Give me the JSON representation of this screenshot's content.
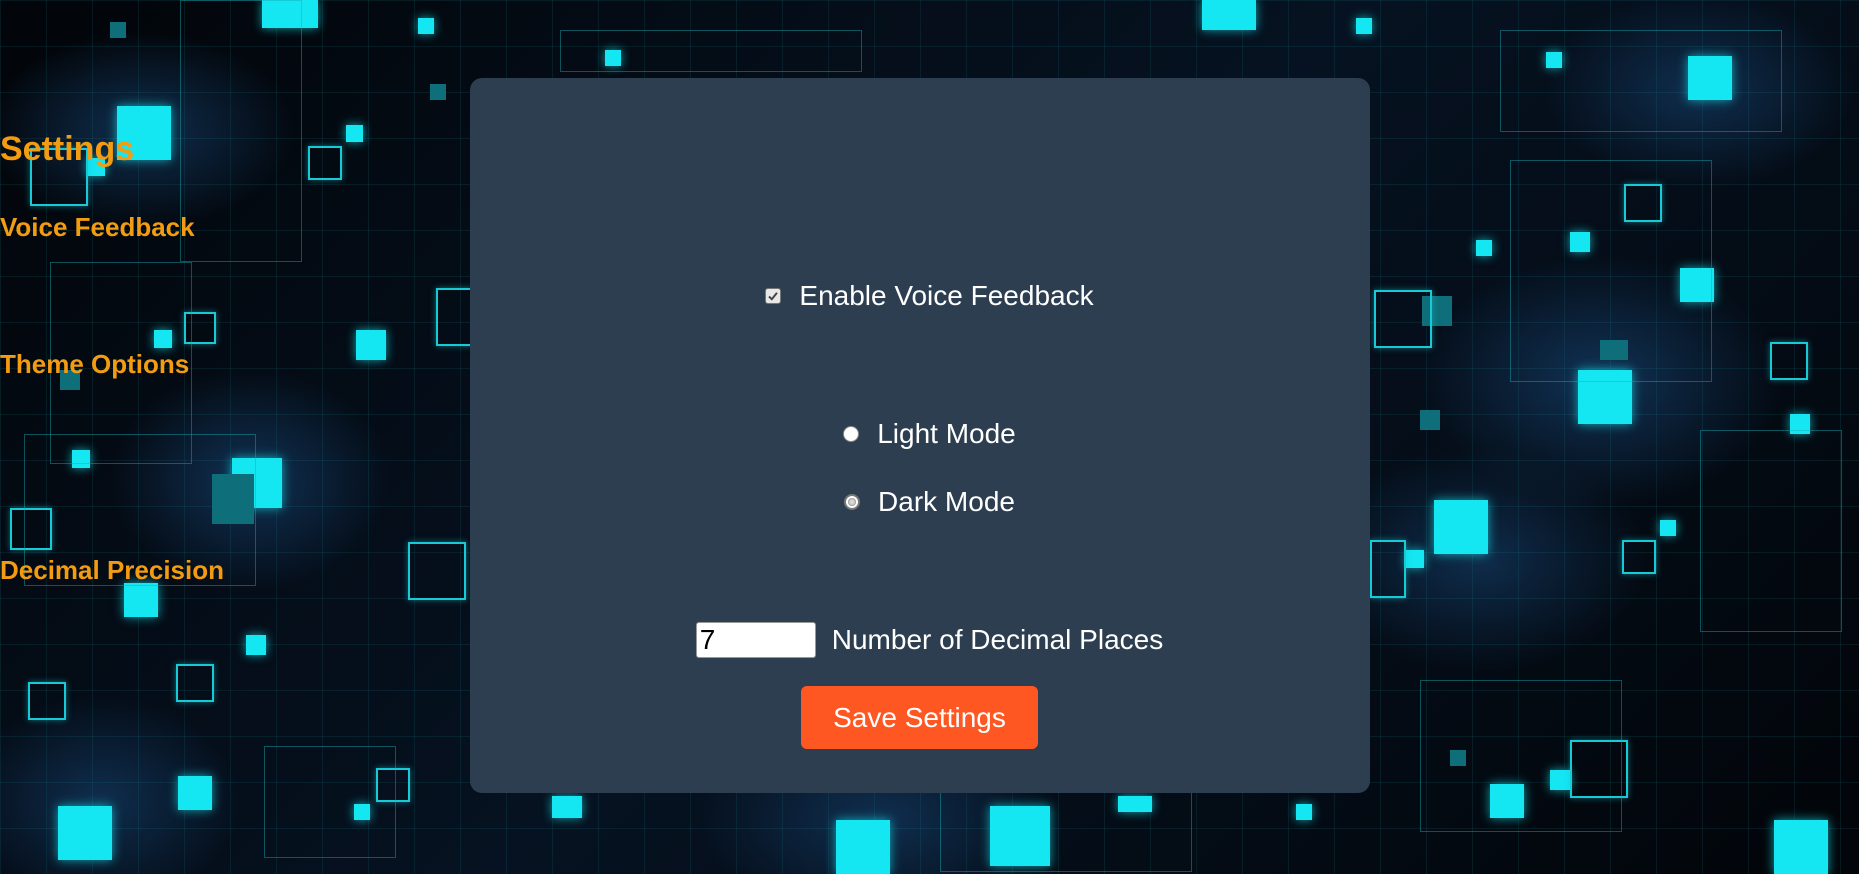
{
  "settings": {
    "title": "Settings",
    "voice_feedback": {
      "heading": "Voice Feedback",
      "enable_label": "Enable Voice Feedback",
      "enabled": true
    },
    "theme": {
      "heading": "Theme Options",
      "light_label": "Light Mode",
      "dark_label": "Dark Mode",
      "selected": "dark"
    },
    "decimal": {
      "heading": "Decimal Precision",
      "value": "7",
      "label": "Number of Decimal Places"
    },
    "save_label": "Save Settings"
  },
  "colors": {
    "panel_bg": "#2c3e50",
    "heading": "#f39c12",
    "button": "#ff5722",
    "accent_cyan": "#14e6f2"
  },
  "icons": {
    "checkbox": "checkmark-icon",
    "radio": "radio-dot-icon"
  }
}
